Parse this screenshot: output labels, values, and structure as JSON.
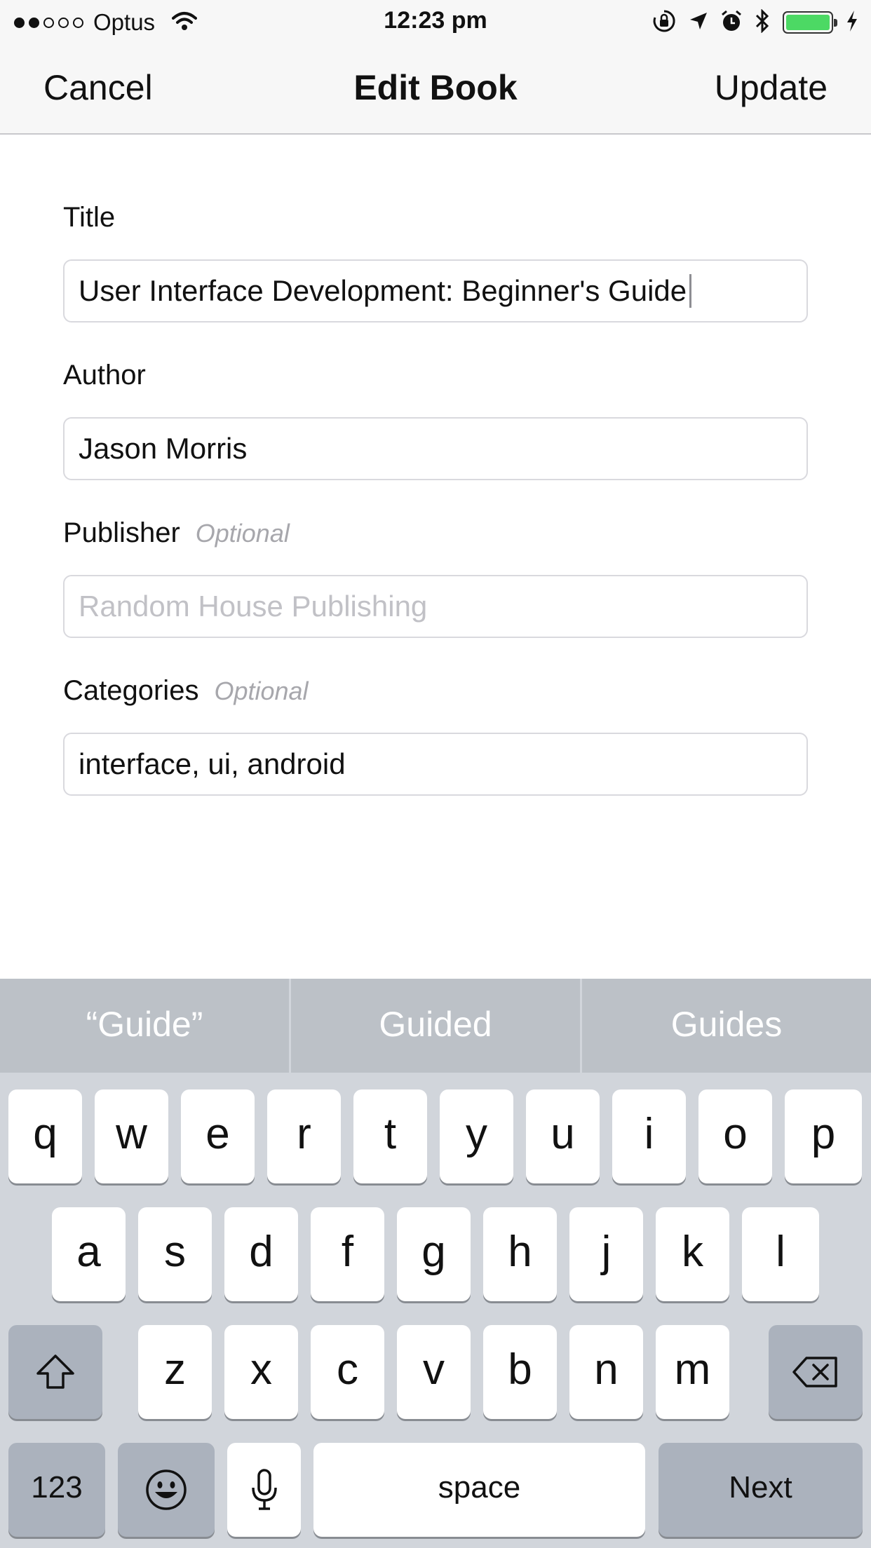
{
  "status_bar": {
    "carrier": "Optus",
    "time": "12:23 pm",
    "signal_bars_filled": 2,
    "signal_bars_total": 5,
    "icons": [
      "wifi-icon",
      "orientation-lock-icon",
      "location-arrow-icon",
      "alarm-icon",
      "bluetooth-icon",
      "battery-icon",
      "charging-bolt-icon"
    ],
    "battery_color": "#4cd964"
  },
  "nav": {
    "cancel_label": "Cancel",
    "title": "Edit Book",
    "update_label": "Update"
  },
  "form": {
    "title": {
      "label": "Title",
      "value": "User Interface Development: Beginner's Guide"
    },
    "author": {
      "label": "Author",
      "value": "Jason Morris"
    },
    "publisher": {
      "label": "Publisher",
      "optional_tag": "Optional",
      "placeholder": "Random House Publishing"
    },
    "categories": {
      "label": "Categories",
      "optional_tag": "Optional",
      "value": "interface, ui, android"
    }
  },
  "keyboard": {
    "suggestions": [
      "“Guide”",
      "Guided",
      "Guides"
    ],
    "row1": [
      "q",
      "w",
      "e",
      "r",
      "t",
      "y",
      "u",
      "i",
      "o",
      "p"
    ],
    "row2": [
      "a",
      "s",
      "d",
      "f",
      "g",
      "h",
      "j",
      "k",
      "l"
    ],
    "row3": [
      "z",
      "x",
      "c",
      "v",
      "b",
      "n",
      "m"
    ],
    "numbers_label": "123",
    "space_label": "space",
    "next_label": "Next",
    "icons": [
      "shift-icon",
      "backspace-icon",
      "emoji-icon",
      "microphone-icon"
    ]
  }
}
